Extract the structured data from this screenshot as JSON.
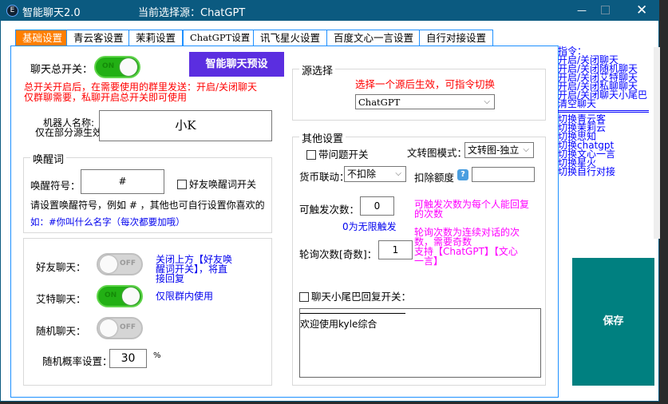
{
  "window": {
    "title": "智能聊天2.0",
    "current_source": "当前选择源：ChatGPT",
    "accent": "#0b5a80"
  },
  "tabs": [
    {
      "label": "基础设置",
      "active": true
    },
    {
      "label": "青云客设置"
    },
    {
      "label": "茉莉设置"
    },
    {
      "label": "ChatGPT设置"
    },
    {
      "label": "讯飞星火设置"
    },
    {
      "label": "百度文心一言设置"
    },
    {
      "label": "自行对接设置"
    }
  ],
  "basic": {
    "master_switch_label": "聊天总开关：",
    "master_switch": "ON",
    "preset_button": "智能聊天预设",
    "master_hint_1": "总开关开启后，在需要使用的群里发送：开启/关闭聊天",
    "master_hint_2": "仅群聊需要，私聊开启总开关即可使用",
    "bot_name_label_1": "机器人名称:",
    "bot_name_label_2": "仅在部分源生效",
    "bot_name": "小K",
    "wake": {
      "title": "唤醒词",
      "symbol_label": "唤醒符号：",
      "symbol": "#",
      "friend_wake_label": "好友唤醒词开关",
      "hint": "请设置唤醒符号，例如 # ，其他也可自行设置你喜欢的",
      "example": "如：#你叫什么名字（每次都要加哦）"
    },
    "friend_chat_label": "好友聊天：",
    "friend_chat": "OFF",
    "friend_chat_hint": "关闭上方【好友唤醒词开关】，将直接回复",
    "at_chat_label": "艾特聊天：",
    "at_chat": "ON",
    "at_chat_hint": "仅限群内使用",
    "random_chat_label": "随机聊天：",
    "random_chat": "OFF",
    "random_prob_label": "随机概率设置：",
    "random_prob": "30",
    "percent": "%"
  },
  "source": {
    "title": "源选择",
    "hint": "选择一个源后生效，可指令切换",
    "selected": "ChatGPT"
  },
  "other": {
    "title": "其他设置",
    "with_question_label": "带问题开关",
    "t2i_mode_label": "文转图模式：",
    "t2i_mode": "文转图-独立",
    "currency_label": "货币联动：",
    "currency": "不扣除",
    "deduct_label": "扣除额度",
    "deduct": "",
    "trigger_label": "可触发次数：",
    "trigger": "0",
    "trigger_note": "0为无限触发",
    "trigger_hint": "可触发次数为每个人能回复的次数",
    "rounds_label": "轮询次数[奇数]：",
    "rounds": "1",
    "rounds_hint_1": "轮询次数为连续对话的次数，需要奇数",
    "rounds_hint_2": "支持【ChatGPT】【文心一言】",
    "tail_label": "聊天小尾巴回复开关：",
    "tail_text": "欢迎使用kyle综合"
  },
  "commands": {
    "title": "指令：",
    "items": [
      "开启/关闭聊天",
      "开启/关闭随机聊天",
      "开启/关闭艾特聊天",
      "开启/关闭私聊聊天",
      "开启/关闭聊天小尾巴",
      "清空聊天"
    ],
    "switch_items": [
      "切换青云客",
      "切换茉莉云",
      "切换思知",
      "切换chatgpt",
      "切换文心一言",
      "切换星火",
      "切换自行对接"
    ]
  },
  "save_button": "保存"
}
